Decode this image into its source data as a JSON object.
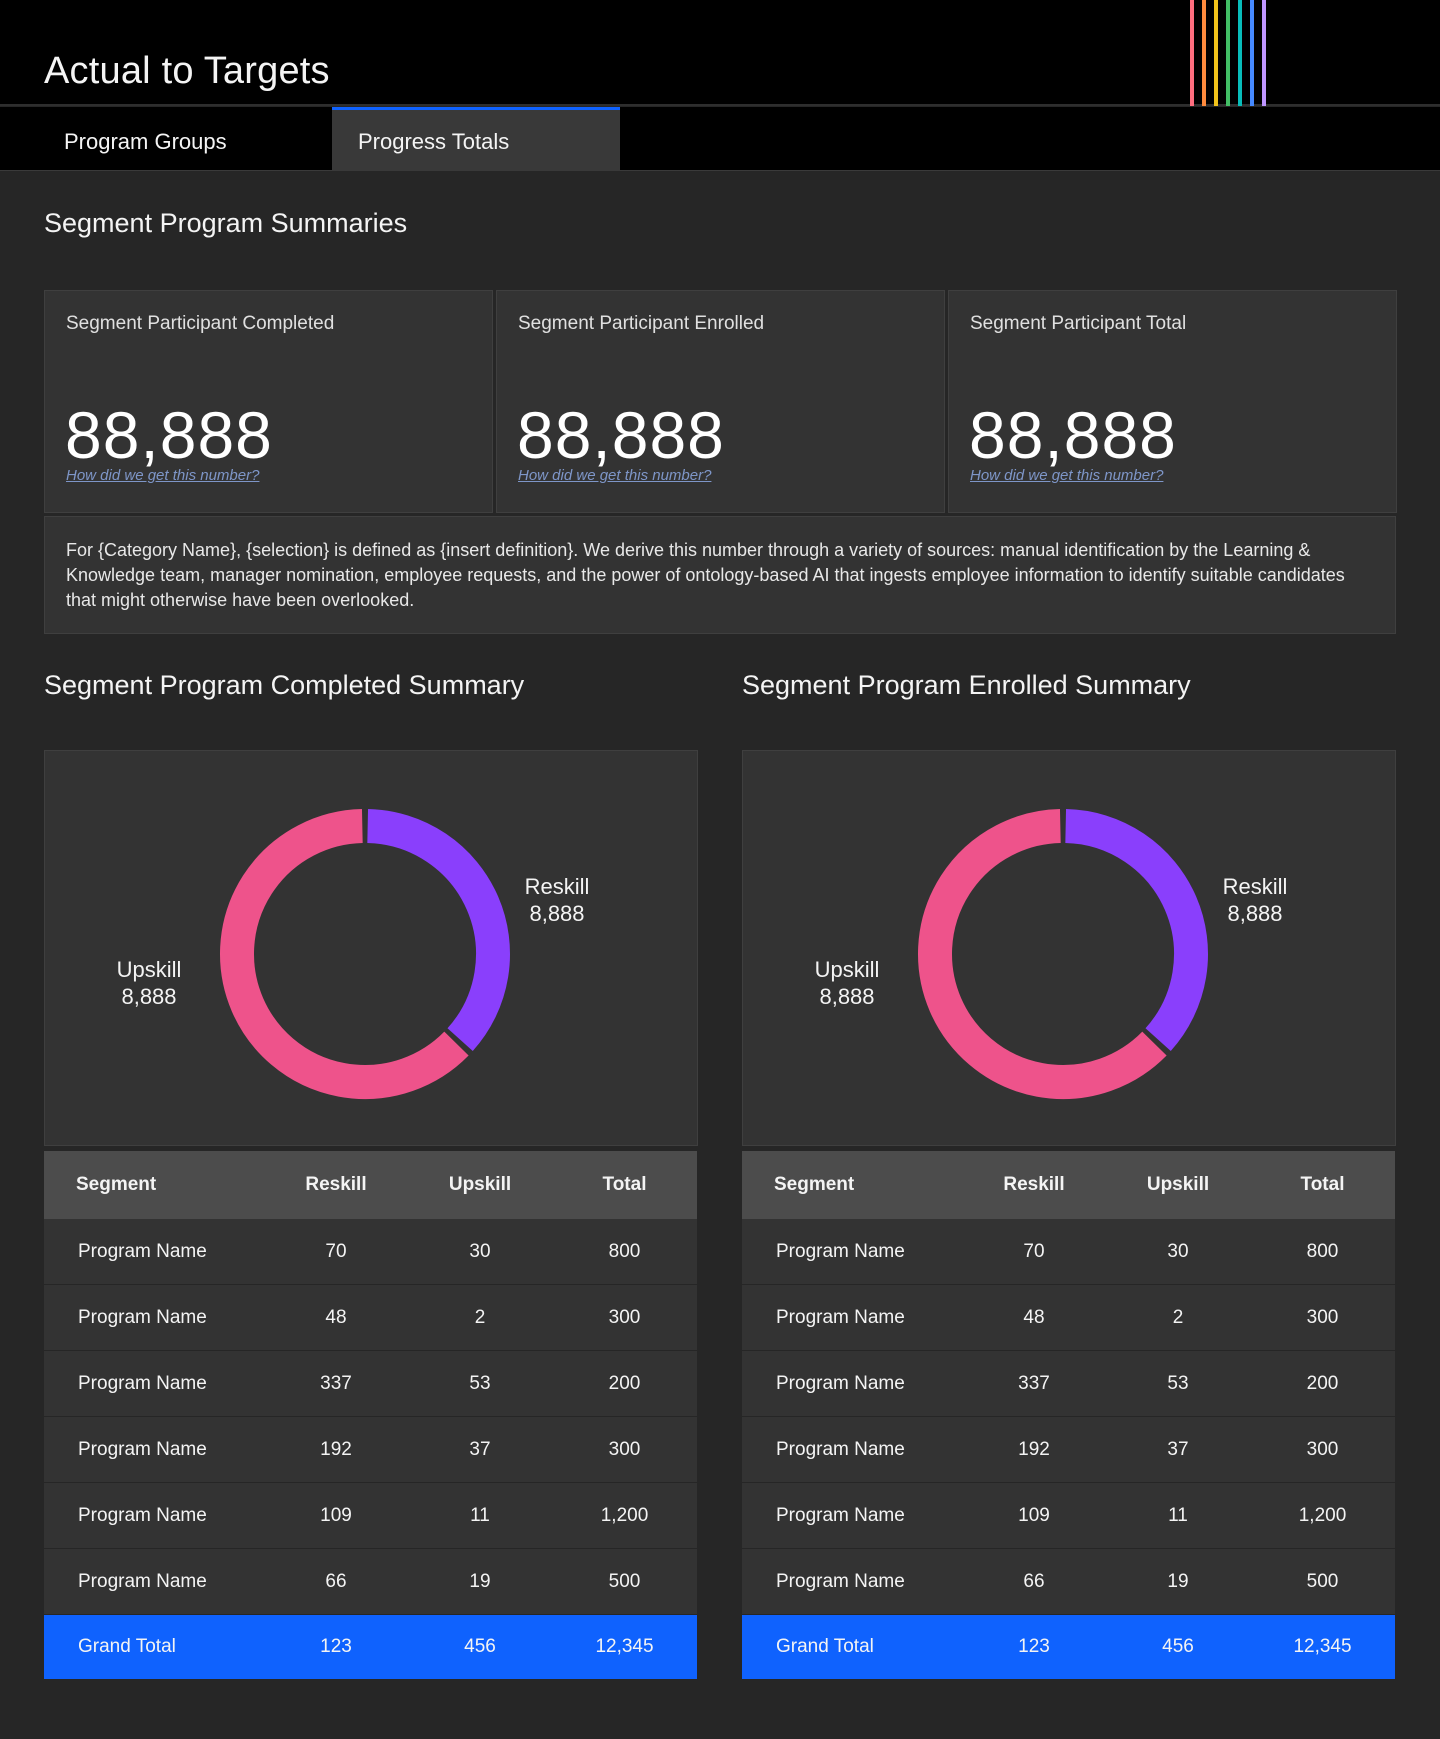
{
  "app": {
    "title": "Actual to Targets"
  },
  "brand": {
    "stripe_colors": [
      "#ff6e7f",
      "#ff8a3d",
      "#f1c21b",
      "#42be65",
      "#08bdba",
      "#4589ff",
      "#be95ff"
    ]
  },
  "tabs": [
    {
      "label": "Program Groups",
      "selected": false
    },
    {
      "label": "Progress Totals",
      "selected": true
    }
  ],
  "summaries": {
    "title": "Segment Program Summaries",
    "kpis": [
      {
        "label": "Segment Participant Completed",
        "value": "88,888",
        "link": "How did we get this number?"
      },
      {
        "label": "Segment Participant Enrolled",
        "value": "88,888",
        "link": "How did we get this number?"
      },
      {
        "label": "Segment Participant Total",
        "value": "88,888",
        "link": "How did we get this number?"
      }
    ],
    "definition": "For {Category Name}, {selection} is defined as {insert definition}. We derive this number through a variety of sources: manual identification by the Learning & Knowledge team, manager nomination, employee requests, and the power of ontology-based AI that ingests employee information to identify suitable candidates that might otherwise have been overlooked."
  },
  "colors": {
    "reskill": "#8a3ffc",
    "upskill": "#ee538b",
    "accent": "#0f62fe"
  },
  "chart_data": [
    {
      "type": "pie",
      "title": "Segment Program Completed Summary",
      "categories": [
        "Reskill",
        "Upskill"
      ],
      "values": [
        37,
        63
      ],
      "labels": [
        "8,888",
        "8,888"
      ]
    },
    {
      "type": "pie",
      "title": "Segment Program Enrolled Summary",
      "categories": [
        "Reskill",
        "Upskill"
      ],
      "values": [
        37,
        63
      ],
      "labels": [
        "8,888",
        "8,888"
      ]
    }
  ],
  "tables": {
    "headers": [
      "Segment",
      "Reskill",
      "Upskill",
      "Total"
    ],
    "completed": {
      "rows": [
        [
          "Program Name",
          "70",
          "30",
          "800"
        ],
        [
          "Program Name",
          "48",
          "2",
          "300"
        ],
        [
          "Program Name",
          "337",
          "53",
          "200"
        ],
        [
          "Program Name",
          "192",
          "37",
          "300"
        ],
        [
          "Program Name",
          "109",
          "11",
          "1,200"
        ],
        [
          "Program Name",
          "66",
          "19",
          "500"
        ]
      ],
      "total": [
        "Grand Total",
        "123",
        "456",
        "12,345"
      ]
    },
    "enrolled": {
      "rows": [
        [
          "Program Name",
          "70",
          "30",
          "800"
        ],
        [
          "Program Name",
          "48",
          "2",
          "300"
        ],
        [
          "Program Name",
          "337",
          "53",
          "200"
        ],
        [
          "Program Name",
          "192",
          "37",
          "300"
        ],
        [
          "Program Name",
          "109",
          "11",
          "1,200"
        ],
        [
          "Program Name",
          "66",
          "19",
          "500"
        ]
      ],
      "total": [
        "Grand Total",
        "123",
        "456",
        "12,345"
      ]
    }
  }
}
